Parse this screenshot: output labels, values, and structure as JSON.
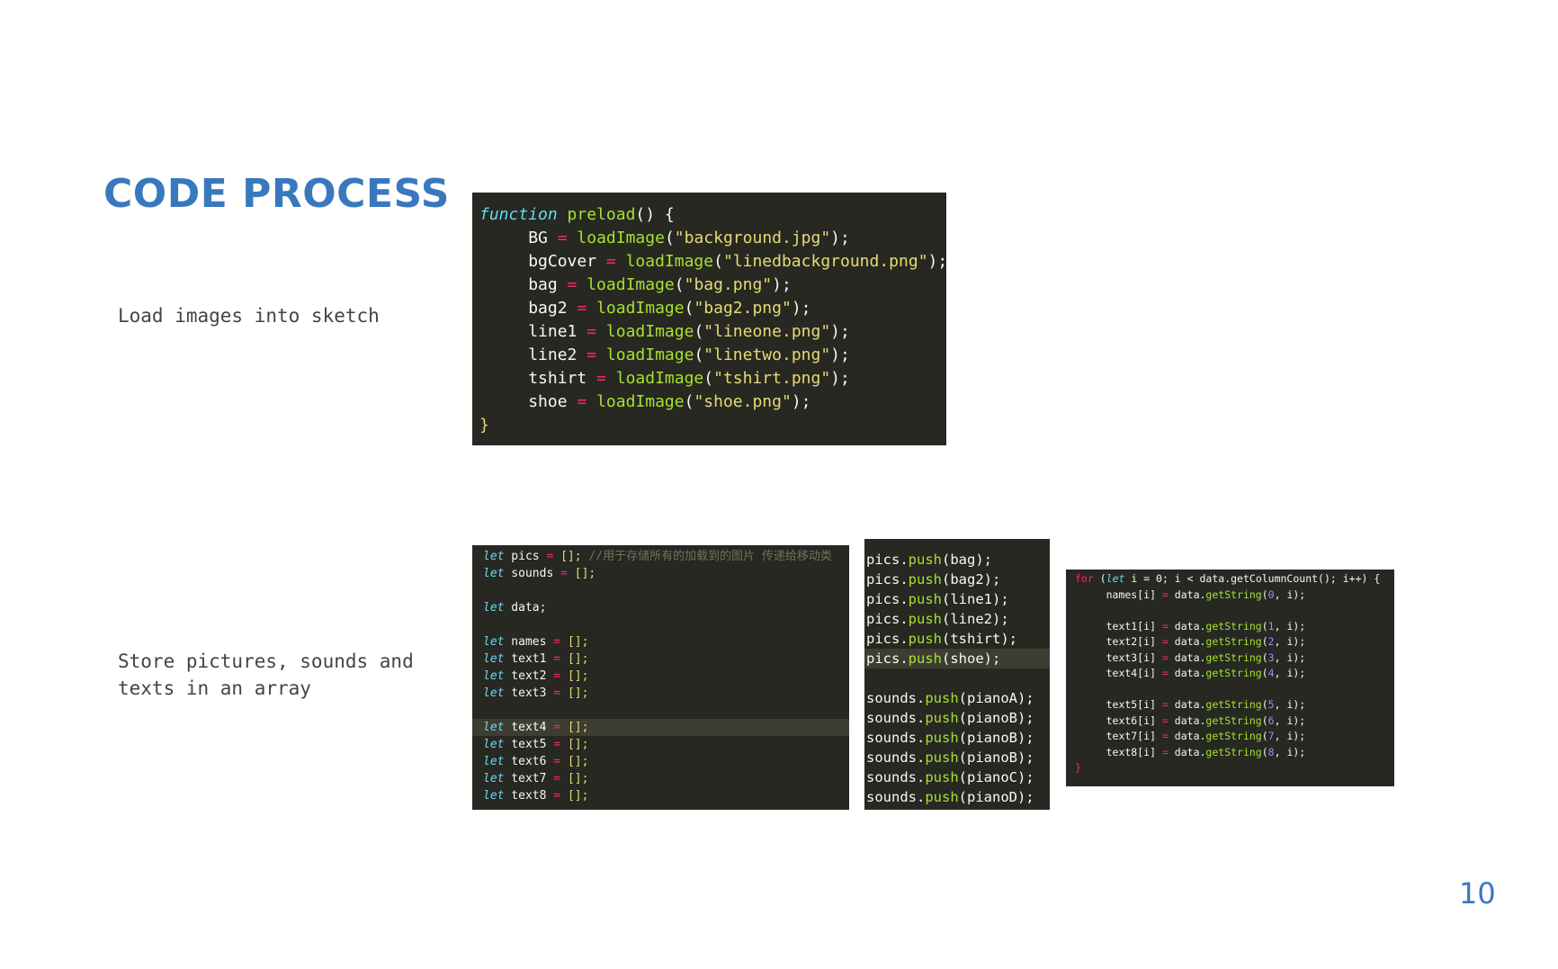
{
  "slide": {
    "title": "CODE PROCESS",
    "caption_load": "Load images into sketch",
    "caption_store": "Store pictures, sounds and\ntexts in an array",
    "page_number": "10"
  },
  "code_preload": {
    "header_kw": "function",
    "header_name": "preload",
    "header_rest": "() {",
    "assignments": [
      {
        "var": "BG",
        "file": "\"background.jpg\""
      },
      {
        "var": "bgCover",
        "file": "\"linedbackground.png\""
      },
      {
        "var": "bag",
        "file": "\"bag.png\""
      },
      {
        "var": "bag2",
        "file": "\"bag2.png\""
      },
      {
        "var": "line1",
        "file": "\"lineone.png\""
      },
      {
        "var": "line2",
        "file": "\"linetwo.png\""
      },
      {
        "var": "tshirt",
        "file": "\"tshirt.png\""
      },
      {
        "var": "shoe",
        "file": "\"shoe.png\""
      }
    ],
    "call": "loadImage",
    "close": "}"
  },
  "code_vars": {
    "keyword": "let",
    "empty_array": "[];",
    "comment": "//用于存储所有的加载到的图片 传递给移动类",
    "lines": [
      {
        "name": "pics",
        "value": "[];",
        "comment": true
      },
      {
        "name": "sounds",
        "value": "[];"
      },
      {
        "blank": true
      },
      {
        "name": "data;",
        "value": ""
      },
      {
        "blank": true
      },
      {
        "name": "names",
        "value": "[];"
      },
      {
        "name": "text1",
        "value": "[];"
      },
      {
        "name": "text2",
        "value": "[];"
      },
      {
        "name": "text3",
        "value": "[];"
      },
      {
        "blank": true
      },
      {
        "name": "text4",
        "value": "[];",
        "highlight": true
      },
      {
        "name": "text5",
        "value": "[];"
      },
      {
        "name": "text6",
        "value": "[];"
      },
      {
        "name": "text7",
        "value": "[];"
      },
      {
        "name": "text8",
        "value": "[];"
      }
    ]
  },
  "code_push": {
    "lines": [
      {
        "target": "pics",
        "arg": "bag"
      },
      {
        "target": "pics",
        "arg": "bag2"
      },
      {
        "target": "pics",
        "arg": "line1"
      },
      {
        "target": "pics",
        "arg": "line2"
      },
      {
        "target": "pics",
        "arg": "tshirt"
      },
      {
        "target": "pics",
        "arg": "shoe"
      },
      {
        "blank": true
      },
      {
        "target": "sounds",
        "arg": "pianoA"
      },
      {
        "target": "sounds",
        "arg": "pianoB"
      },
      {
        "target": "sounds",
        "arg": "pianoB"
      },
      {
        "target": "sounds",
        "arg": "pianoB"
      },
      {
        "target": "sounds",
        "arg": "pianoC"
      },
      {
        "target": "sounds",
        "arg": "pianoD"
      }
    ]
  },
  "code_loop": {
    "header": {
      "for": "for",
      "let": "let",
      "rest": "i = 0; i < data.getColumnCount(); i++) {"
    },
    "lines": [
      {
        "target": "names[i]",
        "col": "0"
      },
      {
        "blank": true
      },
      {
        "target": "text1[i]",
        "col": "1"
      },
      {
        "target": "text2[i]",
        "col": "2"
      },
      {
        "target": "text3[i]",
        "col": "3"
      },
      {
        "target": "text4[i]",
        "col": "4"
      },
      {
        "blank": true
      },
      {
        "target": "text5[i]",
        "col": "5"
      },
      {
        "target": "text6[i]",
        "col": "6"
      },
      {
        "target": "text7[i]",
        "col": "7"
      },
      {
        "target": "text8[i]",
        "col": "8"
      }
    ],
    "close": "}"
  }
}
